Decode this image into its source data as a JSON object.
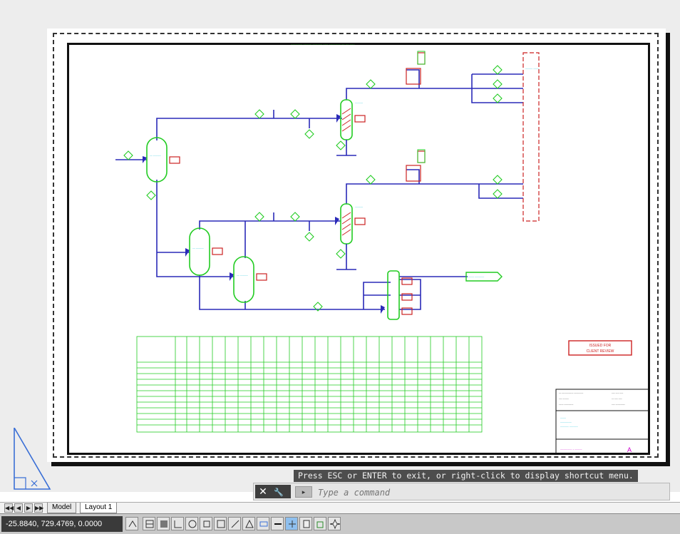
{
  "drawing": {
    "header_note": "~~~~~~~ ~~~~~ ~~~~~~ ~~~ ~~~~~~~ ~~ ~~ ~~~",
    "issue_stamp_line1": "ISSUED FOR",
    "issue_stamp_line2": "CLIENT REVIEW",
    "revision": "A"
  },
  "prompt": {
    "message": "Press ESC or ENTER to exit, or right-click to display shortcut menu."
  },
  "command_line": {
    "close_glyph": "✕",
    "settings_glyph": "🔧",
    "history_label": "▸",
    "placeholder": "Type a command"
  },
  "layout_tabs": {
    "nav": [
      "◀◀",
      "◀",
      "▶",
      "▶▶"
    ],
    "tabs": [
      {
        "label": "Model",
        "active": false
      },
      {
        "label": "Layout 1",
        "active": true
      }
    ]
  },
  "status_bar": {
    "coordinates": "-25.8840, 729.4769, 0.0000",
    "toggles": [
      {
        "icon": "model-space-icon",
        "on": false
      },
      {
        "icon": "grid-display-icon",
        "on": false
      },
      {
        "icon": "snap-mode-icon",
        "on": false
      },
      {
        "icon": "ortho-mode-icon",
        "on": false
      },
      {
        "icon": "polar-tracking-icon",
        "on": false
      },
      {
        "icon": "object-snap-icon",
        "on": false
      },
      {
        "icon": "3d-object-snap-icon",
        "on": false
      },
      {
        "icon": "object-snap-tracking-icon",
        "on": false
      },
      {
        "icon": "dynamic-ucs-icon",
        "on": false
      },
      {
        "icon": "dynamic-input-icon",
        "on": false
      },
      {
        "icon": "lineweight-icon",
        "on": false
      },
      {
        "icon": "transparency-icon",
        "on": true
      },
      {
        "icon": "quick-properties-icon",
        "on": false
      },
      {
        "icon": "selection-cycling-icon",
        "on": false
      },
      {
        "icon": "annotation-monitor-icon",
        "on": false
      }
    ]
  },
  "colors": {
    "equipment": "#22cc22",
    "pipe": "#2a2ab8",
    "instrument": "#cc2222",
    "label": "#00bcd4",
    "frame": "#111111"
  }
}
